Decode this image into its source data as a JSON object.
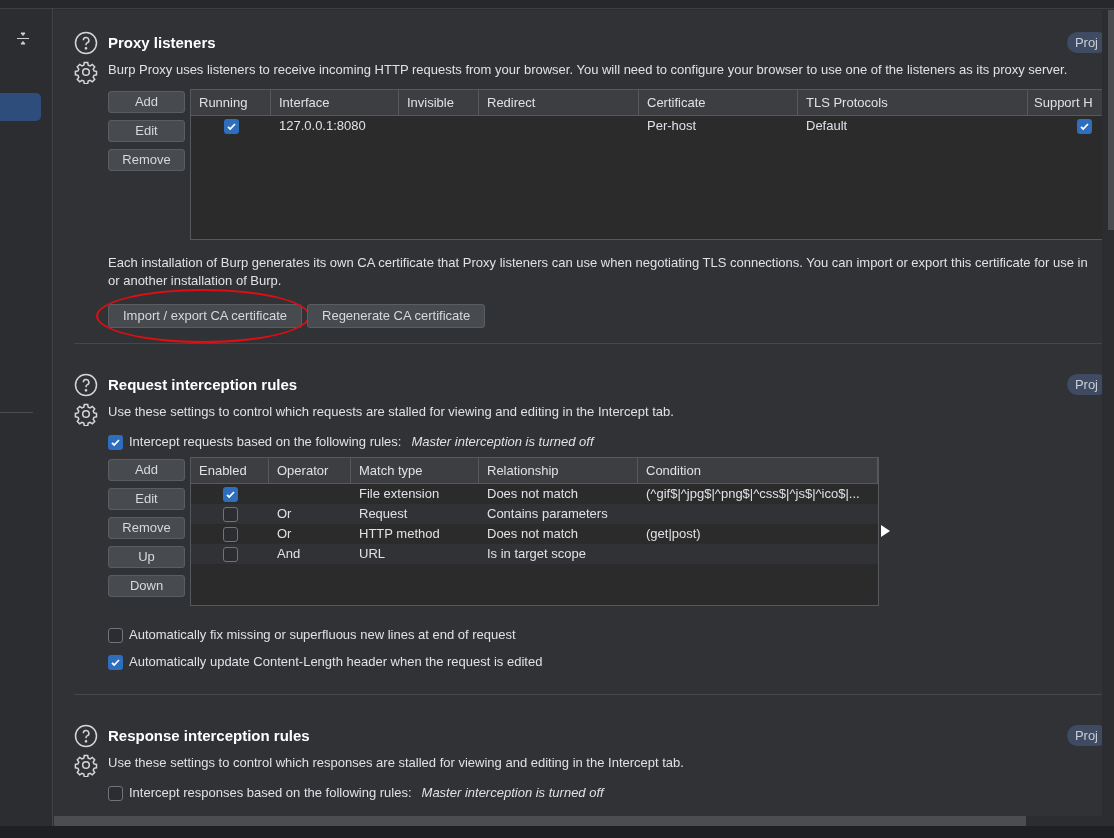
{
  "sections": [
    {
      "title": "Proxy listeners",
      "badge": "Proj",
      "description": "Burp Proxy uses listeners to receive incoming HTTP requests from your browser. You will need to configure your browser to use one of the listeners as its proxy server.",
      "table": {
        "buttons": [
          "Add",
          "Edit",
          "Remove"
        ],
        "columns": [
          {
            "label": "Running",
            "kind": "check"
          },
          {
            "label": "Interface",
            "kind": "text"
          },
          {
            "label": "Invisible",
            "kind": "text"
          },
          {
            "label": "Redirect",
            "kind": "text"
          },
          {
            "label": "Certificate",
            "kind": "text"
          },
          {
            "label": "TLS Protocols",
            "kind": "text"
          },
          {
            "label": "Support H",
            "kind": "check"
          }
        ],
        "rows": [
          {
            "cells": [
              true,
              "127.0.0.1:8080",
              null,
              null,
              "Per-host",
              "Default",
              true
            ]
          }
        ]
      },
      "note": "Each installation of Burp generates its own CA certificate that Proxy listeners can use when negotiating TLS connections. You can import or export this certificate for use in\nor another installation of Burp.",
      "actions": [
        {
          "label": "Import / export CA certificate",
          "circled": true
        },
        {
          "label": "Regenerate CA certificate",
          "circled": false
        }
      ]
    },
    {
      "title": "Request interception rules",
      "badge": "Proj",
      "description": "Use these settings to control which requests are stalled for viewing and editing in the Intercept tab.",
      "master": {
        "label": "Intercept requests based on the following rules:",
        "status": "Master interception is turned off",
        "checked": true
      },
      "table": {
        "buttons": [
          "Add",
          "Edit",
          "Remove",
          "Up",
          "Down"
        ],
        "columns": [
          {
            "label": "Enabled",
            "kind": "check"
          },
          {
            "label": "Operator",
            "kind": "text"
          },
          {
            "label": "Match type",
            "kind": "text"
          },
          {
            "label": "Relationship",
            "kind": "text"
          },
          {
            "label": "Condition",
            "kind": "text"
          }
        ],
        "rows": [
          {
            "cells": [
              true,
              null,
              "File extension",
              "Does not match",
              "(^gif$|^jpg$|^png$|^css$|^js$|^ico$|..."
            ]
          },
          {
            "cells": [
              false,
              "Or",
              "Request",
              "Contains parameters",
              null
            ]
          },
          {
            "cells": [
              false,
              "Or",
              "HTTP method",
              "Does not match",
              "(get|post)"
            ]
          },
          {
            "cells": [
              false,
              "And",
              "URL",
              "Is in target scope",
              null
            ]
          }
        ]
      },
      "options": [
        {
          "label": "Automatically fix missing or superfluous new lines at end of request",
          "checked": false
        },
        {
          "label": "Automatically update Content-Length header when the request is edited",
          "checked": true
        }
      ]
    },
    {
      "title": "Response interception rules",
      "badge": "Proj",
      "description": "Use these settings to control which responses are stalled for viewing and editing in the Intercept tab.",
      "master": {
        "label": "Intercept responses based on the following rules:",
        "status": "Master interception is turned off",
        "checked": false
      }
    }
  ]
}
